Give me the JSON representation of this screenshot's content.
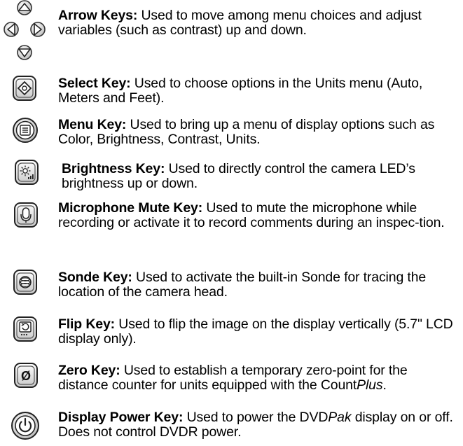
{
  "keys": [
    {
      "icon": "arrow-keys-icon",
      "name": "Arrow Keys:",
      "desc_parts": [
        " Used to move among menu choices and adjust variables (such as contrast) up and down."
      ]
    },
    {
      "icon": "select-key-icon",
      "name": "Select Key:",
      "desc_parts": [
        " Used to choose options in the Units menu (Auto, Meters and Feet)."
      ]
    },
    {
      "icon": "menu-key-icon",
      "name": "Menu Key:",
      "desc_parts": [
        " Used to bring up a menu of display options such as Color, Brightness, Contrast, Units."
      ]
    },
    {
      "icon": "brightness-key-icon",
      "name": "Brightness Key:",
      "desc_parts": [
        " Used to directly control the camera LED’s brightness up or down."
      ]
    },
    {
      "icon": "microphone-mute-key-icon",
      "name": "Microphone Mute Key:",
      "desc_parts": [
        " Used to mute the microphone while recording or activate it to record comments during an inspec-tion."
      ]
    },
    {
      "icon": "sonde-key-icon",
      "name": "Sonde Key:",
      "desc_parts": [
        " Used to activate the built-in Sonde for tracing the location of the camera head."
      ]
    },
    {
      "icon": "flip-key-icon",
      "name": "Flip Key:",
      "desc_parts": [
        " Used to flip the image on the display vertically (5.7\" LCD display only)."
      ]
    },
    {
      "icon": "zero-key-icon",
      "name": "Zero Key:",
      "desc_parts": [
        " Used to establish a temporary zero-point for the distance counter for units equipped with the Count"
      ],
      "desc_italic": "Plus",
      "desc_end": "."
    },
    {
      "icon": "display-power-key-icon",
      "name": "Display Power Key:",
      "desc_parts": [
        " Used to power the DVD"
      ],
      "desc_italic": "Pak",
      "desc_end": " display on or off. Does not control DVDR power."
    }
  ],
  "icon_glyphs": {
    "zero": "Ø"
  }
}
